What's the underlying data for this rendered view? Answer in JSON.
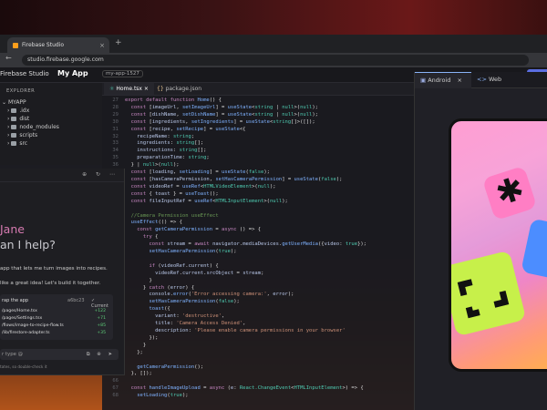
{
  "browser": {
    "tab_title": "Firebase Studio",
    "tab_close": "×",
    "new_tab": "+",
    "nav": "← → ↻",
    "url": "studio.firebase.google.com"
  },
  "app": {
    "brand": "Firebase Studio",
    "name": "My App",
    "workspace": "my-app-1527"
  },
  "explorer": {
    "heading": "EXPLORER",
    "root": "MYAPP",
    "items": [
      ".idx",
      "dist",
      "node_modules",
      "scripts",
      "src"
    ]
  },
  "editor": {
    "tabs": [
      "Home.tsx",
      "package.json"
    ],
    "tab_close": "×"
  },
  "chat": {
    "greeting_name": "Jane",
    "greeting_line2": "an I help?",
    "prompt_text": "app that lets me turn images into recipes.",
    "reply_text": "like a great idea! Let's build it together.",
    "card": {
      "title": "rap the app",
      "commit": "a6bc23",
      "status": "Current",
      "files": [
        {
          "name": "/pages/Home.tsx",
          "added": "+122"
        },
        {
          "name": "/pages/Settings.tsx",
          "added": "+71"
        },
        {
          "name": "/flows/image-to-recipe-flow.ts",
          "added": "+85"
        },
        {
          "name": "/lib/firestore-adapter.ts",
          "added": "+35"
        }
      ]
    },
    "input_placeholder": "r type @",
    "footer": "tates, so double-check it"
  },
  "preview": {
    "tabs": [
      "Android",
      "Web"
    ],
    "tab_close": "×"
  },
  "colors": {
    "accent_pink": "#d57ab0",
    "added_green": "#5fd07a",
    "primary_blue": "#5b6ee1"
  }
}
